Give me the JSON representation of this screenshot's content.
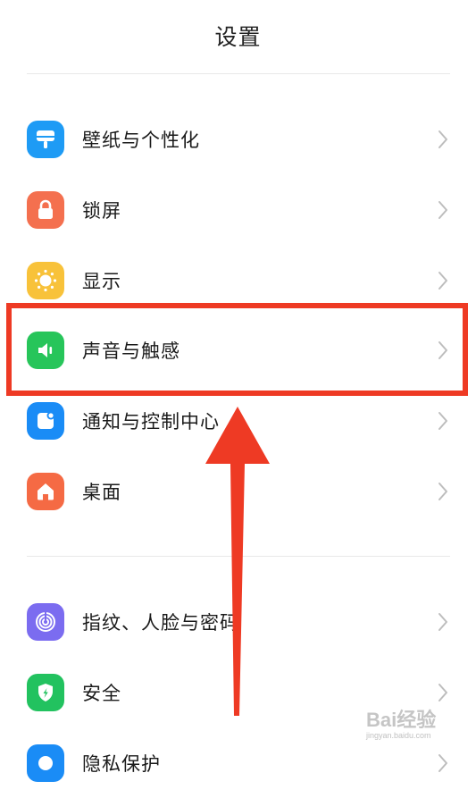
{
  "header": {
    "title": "设置"
  },
  "settings_groups": [
    {
      "items": [
        {
          "label": "壁纸与个性化",
          "icon": "wallpaper-icon",
          "color": "#1e9bf5"
        },
        {
          "label": "锁屏",
          "icon": "lock-icon",
          "color": "#f4704f"
        },
        {
          "label": "显示",
          "icon": "sun-icon",
          "color": "#f8c23a"
        },
        {
          "label": "声音与触感",
          "icon": "speaker-icon",
          "color": "#27c55a"
        },
        {
          "label": "通知与控制中心",
          "icon": "notification-icon",
          "color": "#1a8cf6"
        },
        {
          "label": "桌面",
          "icon": "home-icon",
          "color": "#f56a44"
        }
      ]
    },
    {
      "items": [
        {
          "label": "指纹、人脸与密码",
          "icon": "fingerprint-icon",
          "color": "#7b6cf0"
        },
        {
          "label": "安全",
          "icon": "shield-icon",
          "color": "#22c25f"
        },
        {
          "label": "隐私保护",
          "icon": "privacy-icon",
          "color": "#1a8cf6"
        }
      ]
    }
  ],
  "annotation": {
    "highlight_color": "#ee3a24",
    "highlighted_item": "声音与触感"
  },
  "watermark": {
    "text": "Bai经验",
    "subtext": "jingyan.baidu.com"
  }
}
